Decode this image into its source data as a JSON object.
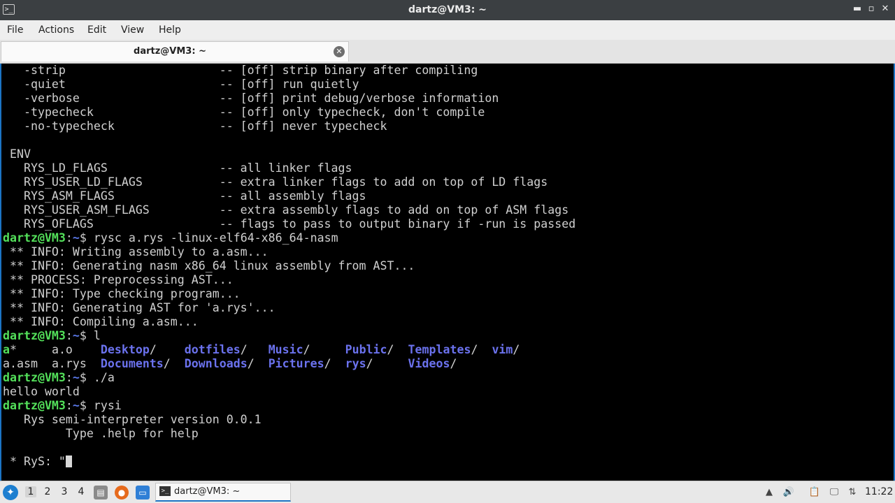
{
  "window": {
    "title": "dartz@VM3: ~",
    "icon": "terminal-icon",
    "controls": {
      "minimize": "▬",
      "restore": "▫",
      "close": "✕"
    }
  },
  "menubar": {
    "items": [
      "File",
      "Actions",
      "Edit",
      "View",
      "Help"
    ]
  },
  "tabs": [
    {
      "label": "dartz@VM3: ~",
      "close": "✕"
    }
  ],
  "terminal": {
    "prompt_user": "dartz@VM3",
    "prompt_sep": ":",
    "prompt_path": "~",
    "prompt_end": "$ ",
    "lines": [
      {
        "type": "text",
        "text": "   -strip                      -- [off] strip binary after compiling"
      },
      {
        "type": "text",
        "text": "   -quiet                      -- [off] run quietly"
      },
      {
        "type": "text",
        "text": "   -verbose                    -- [off] print debug/verbose information"
      },
      {
        "type": "text",
        "text": "   -typecheck                  -- [off] only typecheck, don't compile"
      },
      {
        "type": "text",
        "text": "   -no-typecheck               -- [off] never typecheck"
      },
      {
        "type": "text",
        "text": ""
      },
      {
        "type": "text",
        "text": " ENV"
      },
      {
        "type": "text",
        "text": "   RYS_LD_FLAGS                -- all linker flags"
      },
      {
        "type": "text",
        "text": "   RYS_USER_LD_FLAGS           -- extra linker flags to add on top of LD flags"
      },
      {
        "type": "text",
        "text": "   RYS_ASM_FLAGS               -- all assembly flags"
      },
      {
        "type": "text",
        "text": "   RYS_USER_ASM_FLAGS          -- extra assembly flags to add on top of ASM flags"
      },
      {
        "type": "text",
        "text": "   RYS_OFLAGS                  -- flags to pass to output binary if -run is passed"
      },
      {
        "type": "prompt",
        "cmd": "rysc a.rys -linux-elf64-x86_64-nasm"
      },
      {
        "type": "text",
        "text": " ** INFO: Writing assembly to a.asm..."
      },
      {
        "type": "text",
        "text": " ** INFO: Generating nasm x86_64 linux assembly from AST..."
      },
      {
        "type": "text",
        "text": " ** PROCESS: Preprocessing AST..."
      },
      {
        "type": "text",
        "text": " ** INFO: Type checking program..."
      },
      {
        "type": "text",
        "text": " ** INFO: Generating AST for 'a.rys'..."
      },
      {
        "type": "text",
        "text": " ** INFO: Compiling a.asm..."
      },
      {
        "type": "prompt",
        "cmd": "l"
      },
      {
        "type": "ls",
        "segments": [
          {
            "t": "a",
            "c": "exec"
          },
          {
            "t": "*     ",
            "c": "plain"
          },
          {
            "t": "a.o    ",
            "c": "plain"
          },
          {
            "t": "Desktop",
            "c": "dir"
          },
          {
            "t": "/    ",
            "c": "plain"
          },
          {
            "t": "dotfiles",
            "c": "dir"
          },
          {
            "t": "/   ",
            "c": "plain"
          },
          {
            "t": "Music",
            "c": "dir"
          },
          {
            "t": "/     ",
            "c": "plain"
          },
          {
            "t": "Public",
            "c": "dir"
          },
          {
            "t": "/  ",
            "c": "plain"
          },
          {
            "t": "Templates",
            "c": "dir"
          },
          {
            "t": "/  ",
            "c": "plain"
          },
          {
            "t": "vim",
            "c": "dir"
          },
          {
            "t": "/",
            "c": "plain"
          }
        ]
      },
      {
        "type": "ls",
        "segments": [
          {
            "t": "a.asm  ",
            "c": "plain"
          },
          {
            "t": "a.rys  ",
            "c": "plain"
          },
          {
            "t": "Documents",
            "c": "dir"
          },
          {
            "t": "/  ",
            "c": "plain"
          },
          {
            "t": "Downloads",
            "c": "dir"
          },
          {
            "t": "/  ",
            "c": "plain"
          },
          {
            "t": "Pictures",
            "c": "dir"
          },
          {
            "t": "/  ",
            "c": "plain"
          },
          {
            "t": "rys",
            "c": "dir"
          },
          {
            "t": "/     ",
            "c": "plain"
          },
          {
            "t": "Videos",
            "c": "dir"
          },
          {
            "t": "/",
            "c": "plain"
          }
        ]
      },
      {
        "type": "prompt",
        "cmd": "./a"
      },
      {
        "type": "text",
        "text": "hello world"
      },
      {
        "type": "prompt",
        "cmd": "rysi"
      },
      {
        "type": "text",
        "text": "   Rys semi-interpreter version 0.0.1"
      },
      {
        "type": "text",
        "text": "         Type .help for help"
      },
      {
        "type": "text",
        "text": ""
      },
      {
        "type": "input",
        "text": " * RyS: \""
      }
    ]
  },
  "taskbar": {
    "start_icon": "start-menu-icon",
    "workspaces": [
      "1",
      "2",
      "3",
      "4"
    ],
    "active_workspace": "1",
    "launchers": [
      {
        "name": "file-manager-icon",
        "glyph": "▤",
        "color": "#8a8a8a"
      },
      {
        "name": "firefox-icon",
        "glyph": "●",
        "color": "#e66a1c"
      },
      {
        "name": "show-desktop-icon",
        "glyph": "▭",
        "color": "#2f7fd6"
      }
    ],
    "task": {
      "label": "dartz@VM3: ~",
      "icon": "terminal-icon"
    },
    "tray": [
      {
        "name": "tray-arrow-icon",
        "glyph": "▲"
      },
      {
        "name": "volume-icon",
        "glyph": "🔊"
      },
      {
        "name": "clipboard-icon",
        "glyph": "📋"
      },
      {
        "name": "monitor-icon",
        "glyph": "🖵"
      },
      {
        "name": "network-icon",
        "glyph": "⇅"
      }
    ],
    "clock": "11:22"
  }
}
